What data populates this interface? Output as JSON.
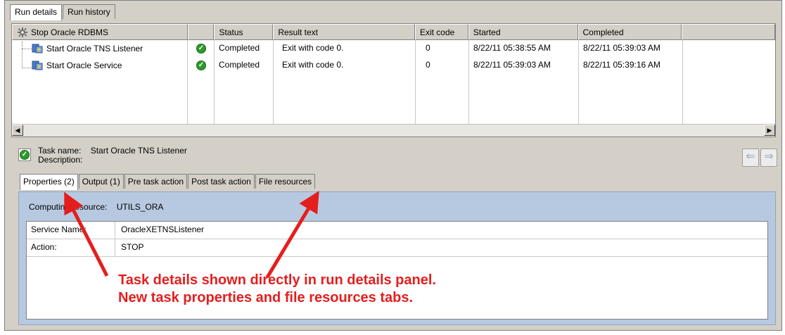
{
  "top_tabs": [
    {
      "label": "Run details",
      "active": true
    },
    {
      "label": "Run history",
      "active": false
    }
  ],
  "grid": {
    "columns": [
      "Stop Oracle RDBMS",
      "",
      "Status",
      "Result text",
      "Exit code",
      "Started",
      "Completed",
      ""
    ],
    "rows": [
      {
        "name": "Start Oracle TNS Listener",
        "status": "Completed",
        "result": "Exit with code 0.",
        "exit_code": "0",
        "started": "8/22/11 05:38:55 AM",
        "completed": "8/22/11 05:39:03 AM"
      },
      {
        "name": "Start Oracle Service",
        "status": "Completed",
        "result": "Exit with code 0.",
        "exit_code": "0",
        "started": "8/22/11 05:39:03 AM",
        "completed": "8/22/11 05:39:16 AM"
      }
    ]
  },
  "task_info": {
    "name_label": "Task name:",
    "name_value": "Start Oracle TNS Listener",
    "description_label": "Description:"
  },
  "sub_tabs": [
    {
      "label": "Properties (2)",
      "active": true
    },
    {
      "label": "Output (1)",
      "active": false
    },
    {
      "label": "Pre task action",
      "active": false
    },
    {
      "label": "Post task action",
      "active": false
    },
    {
      "label": "File resources",
      "active": false
    }
  ],
  "properties": {
    "resource_label": "Computing resource:",
    "resource_value": "UTILS_ORA",
    "rows": [
      {
        "key": "Service Name:",
        "value": "OracleXETNSListener"
      },
      {
        "key": "Action:",
        "value": "STOP"
      }
    ]
  },
  "annotation": {
    "line1": "Task details shown directly in run details panel.",
    "line2": "New task properties and file resources tabs."
  },
  "colors": {
    "window_bg": "#d4d0c8",
    "panel_blue": "#b7c9e0",
    "annotation_red": "#e41e1e",
    "success_green": "#2c9a2c"
  },
  "icons": {
    "header": "gear-icon",
    "task": "service-icon",
    "status": "check-circle-icon",
    "nav_back": "arrow-left-icon",
    "nav_forward": "arrow-right-icon"
  }
}
